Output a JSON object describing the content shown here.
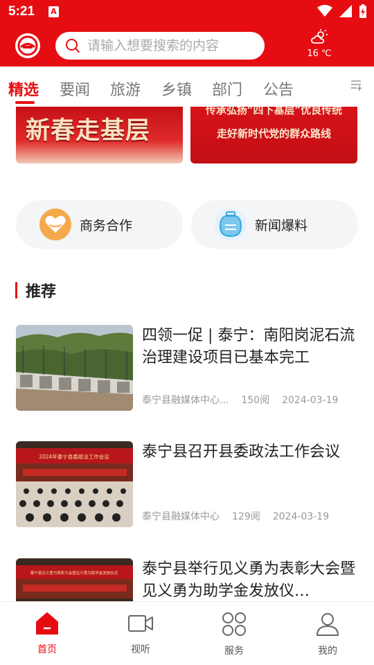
{
  "status_bar": {
    "time": "5:21",
    "app_indicator": "A"
  },
  "header": {
    "search_placeholder": "请输入想要搜索的内容",
    "weather_temp": "16 ℃",
    "weather_icon": "cloud-sun-icon",
    "accent_color": "#e60d12"
  },
  "tabs": [
    {
      "label": "精选",
      "active": true
    },
    {
      "label": "要闻",
      "active": false
    },
    {
      "label": "旅游",
      "active": false
    },
    {
      "label": "乡镇",
      "active": false
    },
    {
      "label": "部门",
      "active": false
    },
    {
      "label": "公告",
      "active": false
    }
  ],
  "banners": {
    "left_text": "新春走基层",
    "right_line1": "传承弘扬“四下基层”优良传统",
    "right_line2": "走好新时代党的群众路线"
  },
  "services": [
    {
      "label": "商务合作",
      "icon": "handshake-heart-icon"
    },
    {
      "label": "新闻爆料",
      "icon": "news-tip-icon"
    }
  ],
  "section": {
    "title": "推荐"
  },
  "news": [
    {
      "headline": "四领一促 | 泰宁：南阳岗泥石流治理建设项目已基本完工",
      "source": "泰宁县融媒体中心...",
      "views": "150阅",
      "date": "2024-03-19"
    },
    {
      "headline": "泰宁县召开县委政法工作会议",
      "source": "泰宁县融媒体中心",
      "views": "129阅",
      "date": "2024-03-19",
      "banner_text": "2024年泰宁县委政法工作会议"
    },
    {
      "headline": "泰宁县举行见义勇为表彰大会暨见义勇为助学金发放仪…",
      "banner_text": "泰宁县见义勇为表彰大会暨见义勇为助学金发放仪式"
    }
  ],
  "bottom_nav": [
    {
      "label": "首页",
      "icon": "home-icon",
      "active": true
    },
    {
      "label": "视听",
      "icon": "video-camera-icon",
      "active": false
    },
    {
      "label": "服务",
      "icon": "grid-circles-icon",
      "active": false
    },
    {
      "label": "我的",
      "icon": "user-icon",
      "active": false
    }
  ]
}
